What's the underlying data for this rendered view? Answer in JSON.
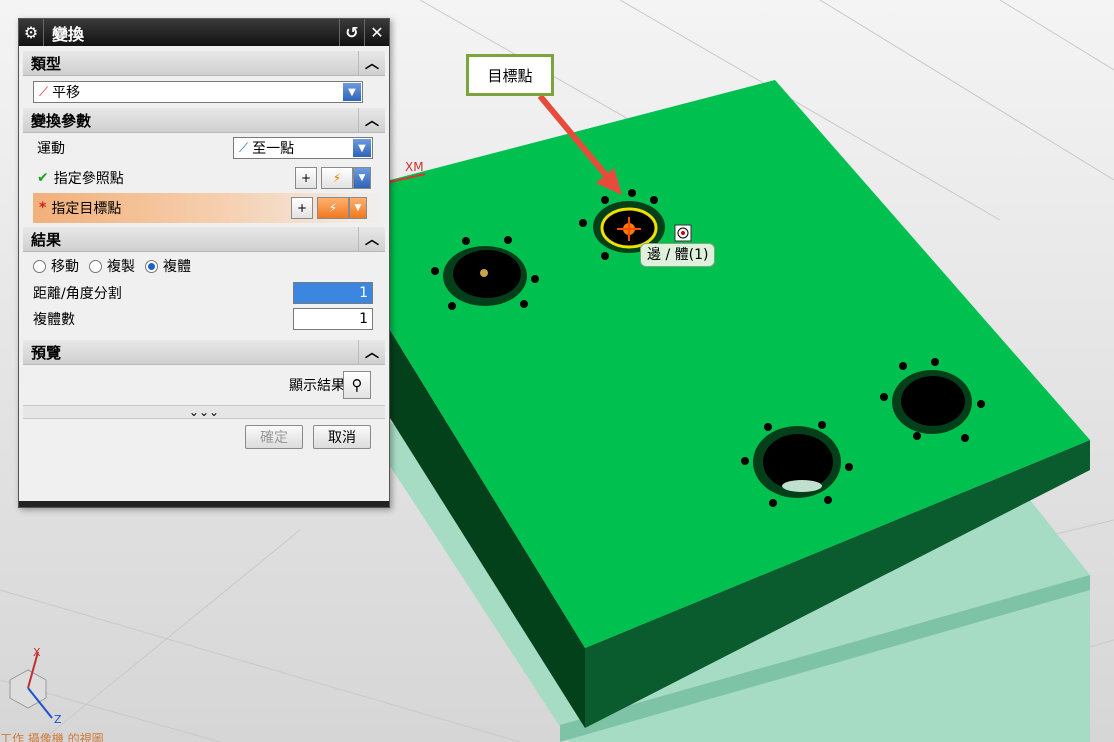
{
  "dialog": {
    "title": "變換",
    "sections": {
      "type": {
        "header": "類型",
        "combo_value": "平移"
      },
      "params": {
        "header": "變換參數",
        "motion_label": "運動",
        "motion_value": "至一點",
        "ref_point_label": "指定參照點",
        "ref_point_mark": "✔",
        "target_point_label": "指定目標點",
        "target_point_mark": "*"
      },
      "result": {
        "header": "結果",
        "options": [
          "移動",
          "複製",
          "複體"
        ],
        "selected": "複體",
        "distance_angle_label": "距離/角度分割",
        "distance_angle_value": "1",
        "copies_label": "複體數",
        "copies_value": "1"
      },
      "preview": {
        "header": "預覽",
        "show_result_label": "顯示結果"
      }
    },
    "ok_label": "確定",
    "cancel_label": "取消",
    "more_label": "⌄⌄⌄"
  },
  "viewport": {
    "callout_label": "目標點",
    "tooltip_label": "邊 / 體(1)",
    "axis_label_xm": "XM",
    "triad_z": "Z",
    "triad_x": "X",
    "status_text": "工作 攝像機 的視圖"
  },
  "colors": {
    "plate_top": "#00c050",
    "plate_side": "#045a28",
    "base_plate": "#9ed8c0",
    "highlight": "#f0e000",
    "accent": "#e84a3c"
  }
}
